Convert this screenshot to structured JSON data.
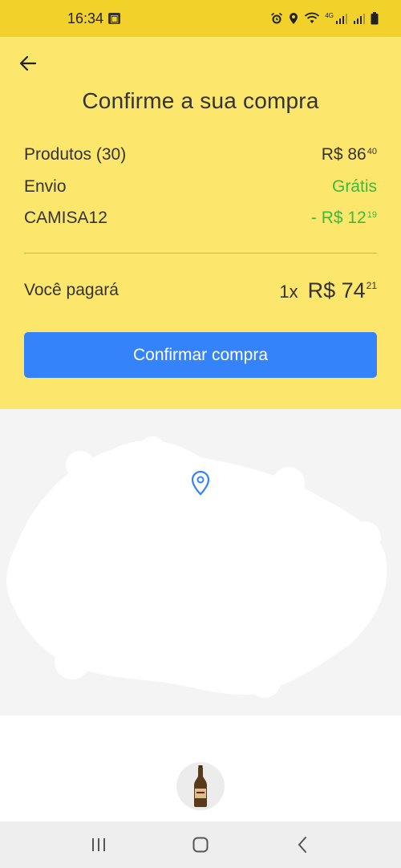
{
  "status_bar": {
    "time": "16:34",
    "left_icon": "gallery-icon",
    "right_icons": [
      "alarm-icon",
      "location-icon",
      "wifi-icon",
      "signal-icon",
      "signal-icon",
      "battery-icon"
    ],
    "network": "4G"
  },
  "header": {
    "back_icon": "arrow-left-icon",
    "title": "Confirme a sua compra"
  },
  "summary": {
    "products_label": "Produtos (30)",
    "products_amount": "R$ 86",
    "products_cents": "40",
    "shipping_label": "Envio",
    "shipping_value": "Grátis",
    "coupon_label": "CAMISA12",
    "coupon_amount": "- R$ 12",
    "coupon_cents": "19"
  },
  "payment": {
    "label": "Você pagará",
    "quantity": "1x",
    "amount": "R$ 74",
    "cents": "21"
  },
  "confirm_button": {
    "label": "Confirmar compra"
  },
  "map": {
    "pin_icon": "location-pin-icon"
  },
  "product": {
    "thumbnail_icon": "beer-bottle-icon"
  },
  "nav_bar": {
    "icons": [
      "recent-apps-icon",
      "home-icon",
      "back-icon"
    ]
  },
  "colors": {
    "header_bg": "#fde66c",
    "status_bg": "#f2d22a",
    "button": "#3483fa",
    "green": "#3fb83f"
  }
}
